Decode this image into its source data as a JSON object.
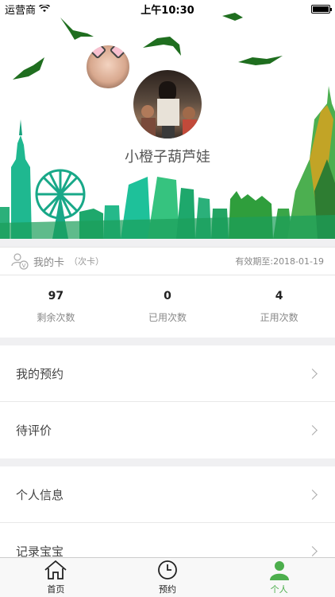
{
  "status_bar": {
    "carrier": "运营商",
    "time": "上午10:30",
    "battery_level": 1.0
  },
  "profile": {
    "username": "小橙子葫芦娃"
  },
  "card": {
    "title": "我的卡",
    "subtitle": "（次卡）",
    "expiry": "有效期至:2018-01-19"
  },
  "stats": [
    {
      "value": "97",
      "label": "剩余次数"
    },
    {
      "value": "0",
      "label": "已用次数"
    },
    {
      "value": "4",
      "label": "正用次数"
    }
  ],
  "menu_groups": [
    {
      "items": [
        {
          "label": "我的预约"
        },
        {
          "label": "待评价"
        }
      ]
    },
    {
      "items": [
        {
          "label": "个人信息"
        },
        {
          "label": "记录宝宝"
        }
      ]
    }
  ],
  "tabs": [
    {
      "label": "首页",
      "icon": "home-icon",
      "active": false
    },
    {
      "label": "预约",
      "icon": "clock-icon",
      "active": false
    },
    {
      "label": "个人",
      "icon": "person-icon",
      "active": true
    }
  ],
  "colors": {
    "accent": "#4cae4c",
    "skyline_teal": "#1fb890",
    "skyline_green": "#2f9e3c",
    "bird": "#1f6e1f"
  }
}
